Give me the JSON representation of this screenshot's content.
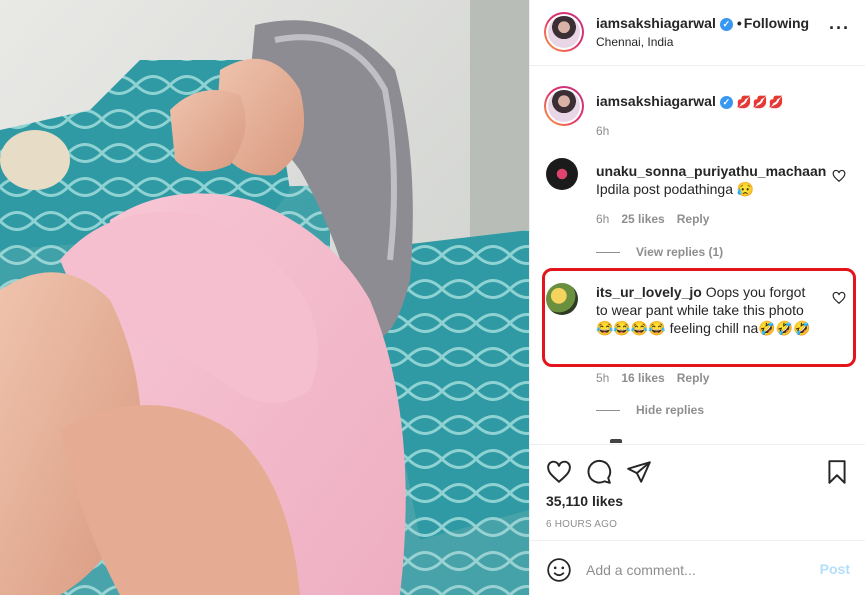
{
  "post": {
    "username": "iamsakshiagarwal",
    "follow_status": "Following",
    "separator": "•",
    "location": "Chennai, India",
    "more_label": "···",
    "verified_glyph": "✓"
  },
  "caption": {
    "username": "iamsakshiagarwal",
    "text": "💋💋💋",
    "time": "6h"
  },
  "comments": [
    {
      "username": "unaku_sonna_puriyathu_machaan",
      "text": "Ipdila post podathinga 😥",
      "time": "6h",
      "likes": "25 likes",
      "reply_label": "Reply",
      "replies_label": "View replies (1)"
    },
    {
      "username": "its_ur_lovely_jo",
      "text": "Oops you forgot to wear pant while take this photo 😂😂😂😂 feeling chill na🤣🤣🤣",
      "time": "5h",
      "likes": "16 likes",
      "reply_label": "Reply",
      "replies_label": "Hide replies",
      "highlighted": true,
      "highlight_color": "#e3141c"
    }
  ],
  "actions": {
    "icons": [
      "heart-icon",
      "comment-icon",
      "share-icon",
      "bookmark-icon"
    ],
    "likes": "35,110 likes",
    "timestamp": "6 HOURS AGO"
  },
  "composer": {
    "placeholder": "Add a comment...",
    "post_label": "Post",
    "emoji_icon": "smiley-icon"
  },
  "colors": {
    "accent": "#3897f0",
    "post_disabled": "#b2dffc",
    "muted": "#8e8e8e"
  }
}
